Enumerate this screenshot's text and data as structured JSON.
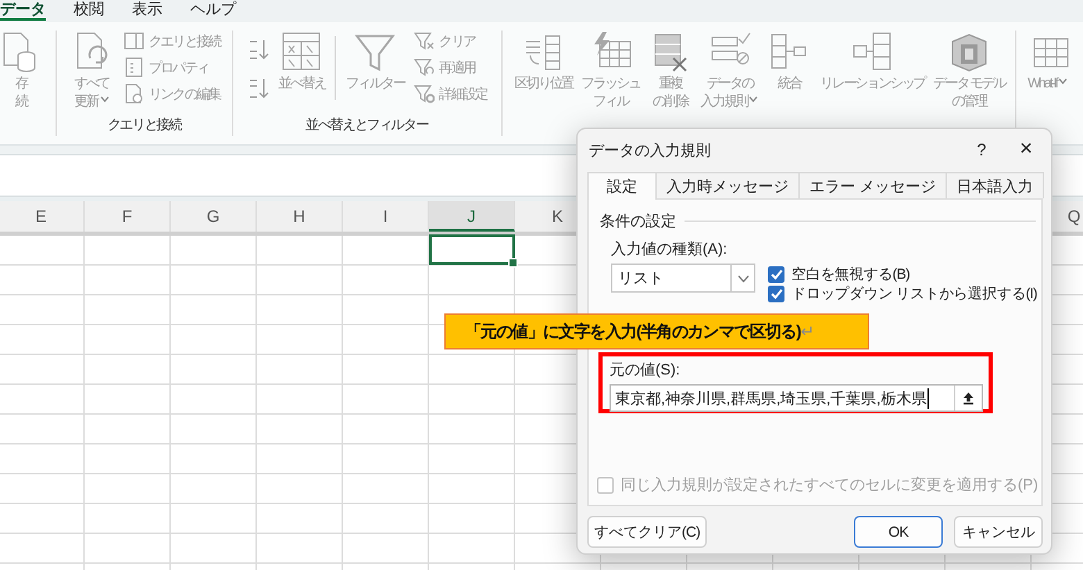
{
  "menu_tabs": [
    {
      "label": "データ",
      "selected": true
    },
    {
      "label": "校閲",
      "selected": false
    },
    {
      "label": "表示",
      "selected": false
    },
    {
      "label": "ヘルプ",
      "selected": false
    }
  ],
  "ribbon": {
    "groups": [
      {
        "buttons": [
          {
            "kind": "large",
            "lines": [
              "存",
              "続"
            ],
            "disabled": true
          }
        ]
      },
      {
        "label": "クエリと接続",
        "buttons": [
          {
            "kind": "large",
            "lines": [
              "すべて",
              "更新"
            ],
            "menu": true,
            "disabled": true
          },
          {
            "kind": "small",
            "label": "クエリと接続",
            "disabled": true
          },
          {
            "kind": "small",
            "label": "プロパティ",
            "disabled": true
          },
          {
            "kind": "small",
            "label": "リンクの編集",
            "disabled": true
          }
        ]
      },
      {
        "label": "並べ替えとフィルター",
        "buttons": [
          {
            "kind": "sort_pair",
            "disabled": true
          },
          {
            "kind": "large",
            "lines": [
              "並べ替え"
            ],
            "disabled": true
          },
          {
            "kind": "divider"
          },
          {
            "kind": "large",
            "lines": [
              "フィルター"
            ],
            "disabled": true
          },
          {
            "kind": "small",
            "label": "クリア",
            "disabled": true
          },
          {
            "kind": "small",
            "label": "再適用",
            "disabled": true
          },
          {
            "kind": "small",
            "label": "詳細設定",
            "disabled": true
          }
        ]
      },
      {
        "buttons": [
          {
            "kind": "large",
            "lines": [
              "区切り位置"
            ],
            "disabled": true
          },
          {
            "kind": "large",
            "lines": [
              "フラッシュ",
              "フィル"
            ],
            "disabled": true
          },
          {
            "kind": "large",
            "lines": [
              "重複",
              "の削除"
            ],
            "disabled": true
          },
          {
            "kind": "large",
            "lines": [
              "データの",
              "入力規則"
            ],
            "menu": true,
            "disabled": true
          },
          {
            "kind": "large",
            "lines": [
              "統合"
            ],
            "disabled": true
          },
          {
            "kind": "large",
            "lines": [
              "リレーションシップ"
            ],
            "disabled": true
          },
          {
            "kind": "large",
            "lines": [
              "データ モデル",
              "の管理"
            ],
            "disabled": true
          }
        ]
      },
      {
        "buttons": [
          {
            "kind": "large",
            "lines": [
              "What-If"
            ],
            "menu": true,
            "disabled": true
          }
        ]
      }
    ]
  },
  "sheet": {
    "columns": [
      {
        "label": "E",
        "selected": false
      },
      {
        "label": "F",
        "selected": false
      },
      {
        "label": "G",
        "selected": false
      },
      {
        "label": "H",
        "selected": false
      },
      {
        "label": "I",
        "selected": false
      },
      {
        "label": "J",
        "selected": true
      },
      {
        "label": "K",
        "selected": false
      }
    ],
    "columns_right": [
      {
        "label": "Q",
        "selected": false
      }
    ]
  },
  "dialog": {
    "title": "データの入力規則",
    "help": "?",
    "close": "×",
    "tabs": [
      {
        "label": "設定",
        "selected": true
      },
      {
        "label": "入力時メッセージ",
        "selected": false
      },
      {
        "label": "エラー メッセージ",
        "selected": false
      },
      {
        "label": "日本語入力",
        "selected": false
      }
    ],
    "section_title": "条件の設定",
    "allow_label": "入力値の種類(A):",
    "allow_value": "リスト",
    "options": [
      {
        "label": "空白を無視する(B)",
        "checked": true
      },
      {
        "label": "ドロップダウン リストから選択する(I)",
        "checked": true
      }
    ],
    "source_label": "元の値(S):",
    "source_value": "東京都,神奈川県,群馬県,埼玉県,千葉県,栃木県",
    "apply_all": {
      "label": "同じ入力規則が設定されたすべてのセルに変更を適用する(P)",
      "checked": false,
      "disabled": true
    },
    "buttons": [
      {
        "label": "すべてクリア(C)",
        "kind": "secondary"
      },
      {
        "label": "OK",
        "kind": "default"
      },
      {
        "label": "キャンセル",
        "kind": "secondary"
      }
    ]
  },
  "callout": {
    "text": "「元の値」に文字を入力(半角のカンマで区切る)",
    "mark": "↵"
  }
}
